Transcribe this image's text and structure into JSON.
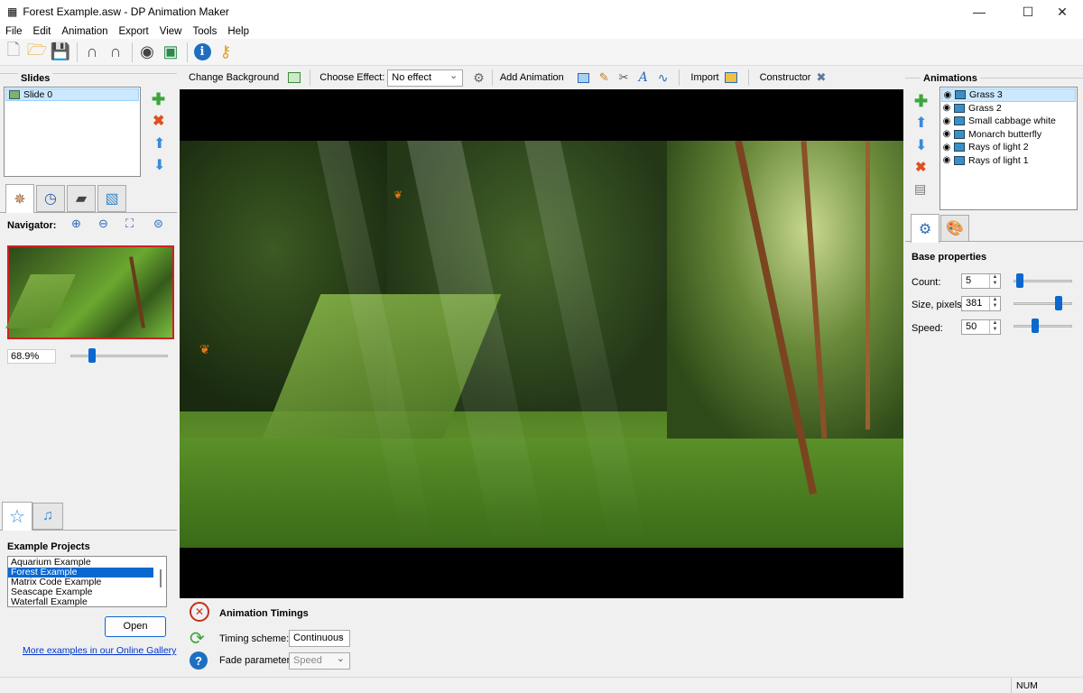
{
  "window": {
    "title": "Forest Example.asw - DP Animation Maker"
  },
  "menu": [
    "File",
    "Edit",
    "Animation",
    "Export",
    "View",
    "Tools",
    "Help"
  ],
  "toolbar_icons": [
    "new-file-icon",
    "open-folder-icon",
    "save-icon",
    "undo-icon",
    "redo-icon",
    "preview-eye-icon",
    "export-icon",
    "info-icon",
    "key-icon"
  ],
  "slides": {
    "header": "Slides",
    "items": [
      "Slide 0"
    ]
  },
  "navigator": {
    "label": "Navigator:",
    "zoom": "68.9%",
    "zoom_fraction": 0.2
  },
  "effects_bar": {
    "change_background": "Change Background",
    "choose_effect_label": "Choose Effect:",
    "choose_effect_value": "No effect",
    "add_animation": "Add Animation",
    "import": "Import",
    "constructor": "Constructor"
  },
  "examples": {
    "header": "Example Projects",
    "items": [
      "Aquarium Example",
      "Forest Example",
      "Matrix Code Example",
      "Seascape Example",
      "Waterfall Example"
    ],
    "selected": 1,
    "open_button": "Open",
    "gallery_link": "More examples in our Online Gallery"
  },
  "animations": {
    "header": "Animations",
    "items": [
      "Grass 3",
      "Grass 2",
      "Small cabbage white",
      "Monarch butterfly",
      "Rays of light 2",
      "Rays of light 1"
    ],
    "selected": 0
  },
  "base_properties": {
    "header": "Base properties",
    "count_label": "Count:",
    "count_value": "5",
    "count_fraction": 0.05,
    "size_label": "Size, pixels:",
    "size_value": "381",
    "size_fraction": 0.8,
    "speed_label": "Speed:",
    "speed_value": "50",
    "speed_fraction": 0.35
  },
  "timings": {
    "header": "Animation Timings",
    "scheme_label": "Timing scheme:",
    "scheme_value": "Continuous",
    "fade_label": "Fade parameter:",
    "fade_value": "Speed"
  },
  "status": {
    "num": "NUM"
  },
  "colors": {
    "accent": "#0a68d0",
    "selection": "#cce8ff",
    "link": "#0033cc"
  }
}
